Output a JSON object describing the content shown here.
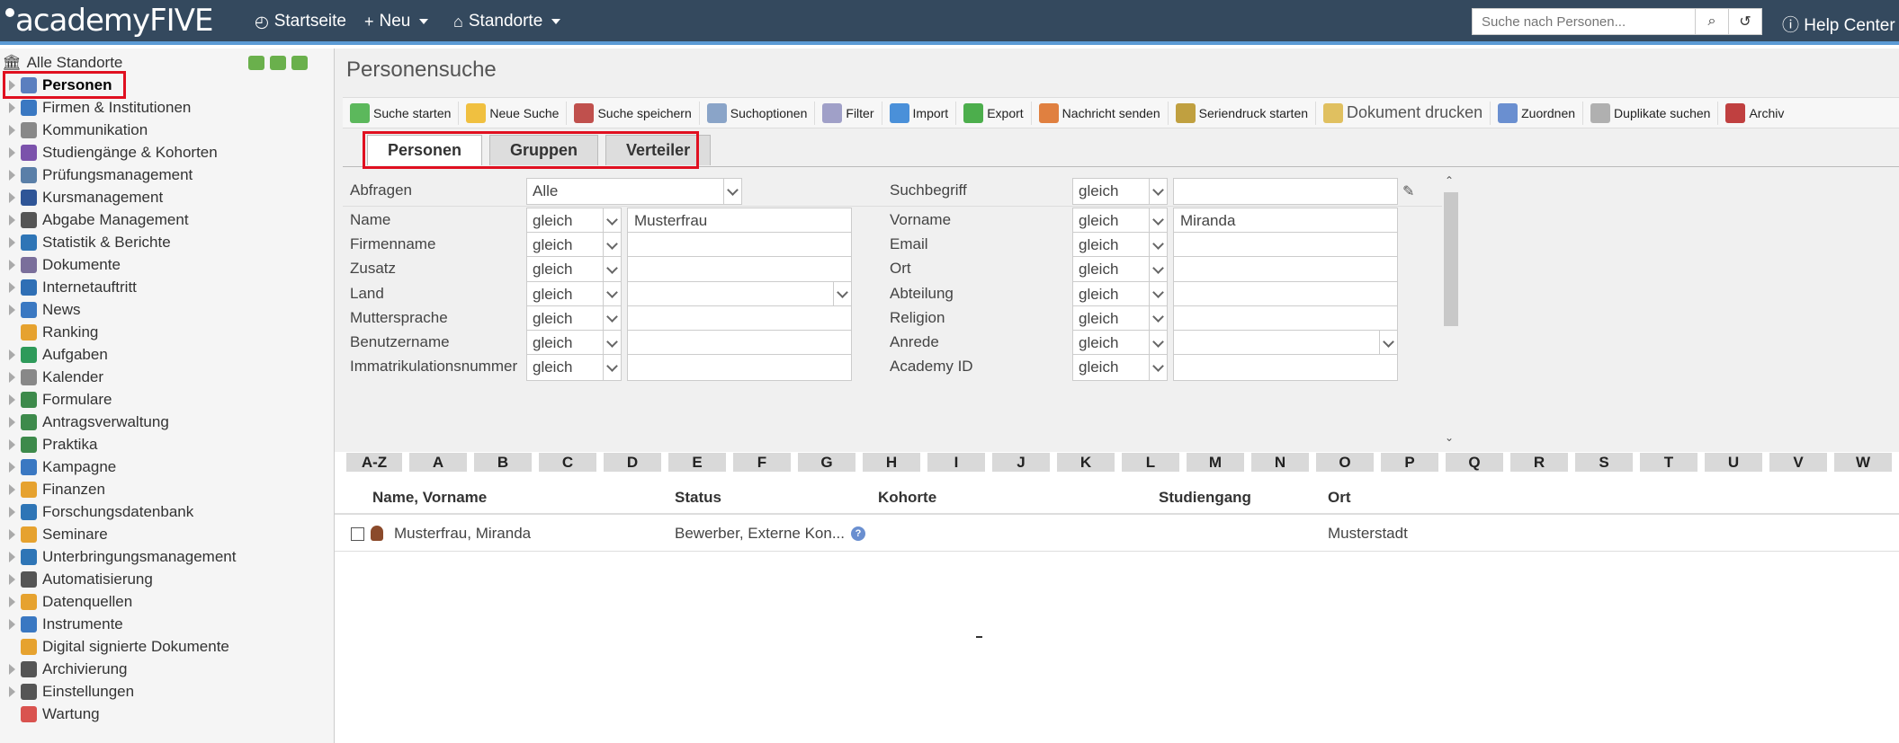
{
  "topbar": {
    "logo": "academyFIVE",
    "nav": [
      {
        "label": "Startseite",
        "icon": "dashboard-icon"
      },
      {
        "label": "Neu",
        "icon": "plus-icon"
      },
      {
        "label": "Standorte",
        "icon": "home-icon"
      }
    ],
    "search_placeholder": "Suche nach Personen...",
    "help_label": "Help Center"
  },
  "sidebar": {
    "root_label": "Alle Standorte",
    "items": [
      {
        "label": "Personen",
        "active": true,
        "color": "#5b7fbf"
      },
      {
        "label": "Firmen & Institutionen",
        "color": "#3a78c2"
      },
      {
        "label": "Kommunikation",
        "color": "#888888"
      },
      {
        "label": "Studiengänge & Kohorten",
        "color": "#7b52ab"
      },
      {
        "label": "Prüfungsmanagement",
        "color": "#5a7fa8"
      },
      {
        "label": "Kursmanagement",
        "color": "#2f5597"
      },
      {
        "label": "Abgabe Management",
        "color": "#555555"
      },
      {
        "label": "Statistik & Berichte",
        "color": "#2e75b6"
      },
      {
        "label": "Dokumente",
        "color": "#7a6f9b"
      },
      {
        "label": "Internetauftritt",
        "color": "#2f6fb5"
      },
      {
        "label": "News",
        "color": "#3a78c2"
      },
      {
        "label": "Ranking",
        "color": "#e6a22f"
      },
      {
        "label": "Aufgaben",
        "color": "#2e9a5a"
      },
      {
        "label": "Kalender",
        "color": "#888888"
      },
      {
        "label": "Formulare",
        "color": "#3d8a4b"
      },
      {
        "label": "Antragsverwaltung",
        "color": "#3d8a4b"
      },
      {
        "label": "Praktika",
        "color": "#3d8a4b"
      },
      {
        "label": "Kampagne",
        "color": "#3a78c2"
      },
      {
        "label": "Finanzen",
        "color": "#e6a22f"
      },
      {
        "label": "Forschungsdatenbank",
        "color": "#2e75b6"
      },
      {
        "label": "Seminare",
        "color": "#e6a22f"
      },
      {
        "label": "Unterbringungsmanagement",
        "color": "#2e75b6"
      },
      {
        "label": "Automatisierung",
        "color": "#555555"
      },
      {
        "label": "Datenquellen",
        "color": "#e6a22f"
      },
      {
        "label": "Instrumente",
        "color": "#3a78c2"
      },
      {
        "label": "Digital signierte Dokumente",
        "color": "#e6a22f"
      },
      {
        "label": "Archivierung",
        "color": "#555555"
      },
      {
        "label": "Einstellungen",
        "color": "#555555"
      },
      {
        "label": "Wartung",
        "color": "#d9534f"
      }
    ]
  },
  "main": {
    "title": "Personensuche",
    "toolbar": [
      {
        "label": "Suche starten",
        "color": "#5cb85c"
      },
      {
        "label": "Neue Suche",
        "color": "#f0c040"
      },
      {
        "label": "Suche speichern",
        "color": "#c0504d"
      },
      {
        "label": "Suchoptionen",
        "color": "#8aa4c8"
      },
      {
        "label": "Filter",
        "color": "#a0a0c8"
      },
      {
        "label": "Import",
        "color": "#4a90d9"
      },
      {
        "label": "Export",
        "color": "#4cae4c"
      },
      {
        "label": "Nachricht senden",
        "color": "#e08040"
      },
      {
        "label": "Seriendruck starten",
        "color": "#c0a040"
      },
      {
        "label": "Dokument drucken",
        "color": "#e0c060"
      },
      {
        "label": "Zuordnen",
        "color": "#6a8fd0"
      },
      {
        "label": "Duplikate suchen",
        "color": "#b0b0b0"
      },
      {
        "label": "Archiv",
        "color": "#c04040"
      }
    ],
    "tabs": [
      "Personen",
      "Gruppen",
      "Verteiler"
    ],
    "form": {
      "abfragen_label": "Abfragen",
      "abfragen_value": "Alle",
      "suchbegriff_label": "Suchbegriff",
      "operator": "gleich",
      "left_fields": [
        {
          "label": "Name",
          "value": "Musterfrau"
        },
        {
          "label": "Firmenname",
          "value": ""
        },
        {
          "label": "Zusatz",
          "value": ""
        },
        {
          "label": "Land",
          "value": ""
        },
        {
          "label": "Muttersprache",
          "value": ""
        },
        {
          "label": "Benutzername",
          "value": ""
        },
        {
          "label": "Immatrikulationsnummer",
          "value": ""
        }
      ],
      "right_fields": [
        {
          "label": "Vorname",
          "value": "Miranda"
        },
        {
          "label": "Email",
          "value": ""
        },
        {
          "label": "Ort",
          "value": ""
        },
        {
          "label": "Abteilung",
          "value": ""
        },
        {
          "label": "Religion",
          "value": ""
        },
        {
          "label": "Anrede",
          "value": ""
        },
        {
          "label": "Academy ID",
          "value": ""
        }
      ]
    },
    "alphabet": [
      "A-Z",
      "A",
      "B",
      "C",
      "D",
      "E",
      "F",
      "G",
      "H",
      "I",
      "J",
      "K",
      "L",
      "M",
      "N",
      "O",
      "P",
      "Q",
      "R",
      "S",
      "T",
      "U",
      "V",
      "W"
    ],
    "results": {
      "columns": [
        "Name, Vorname",
        "Status",
        "Kohorte",
        "Studiengang",
        "Ort"
      ],
      "rows": [
        {
          "name": "Musterfrau, Miranda",
          "status": "Bewerber, Externe Kon...",
          "kohorte": "",
          "studiengang": "",
          "ort": "Musterstadt"
        }
      ]
    }
  }
}
